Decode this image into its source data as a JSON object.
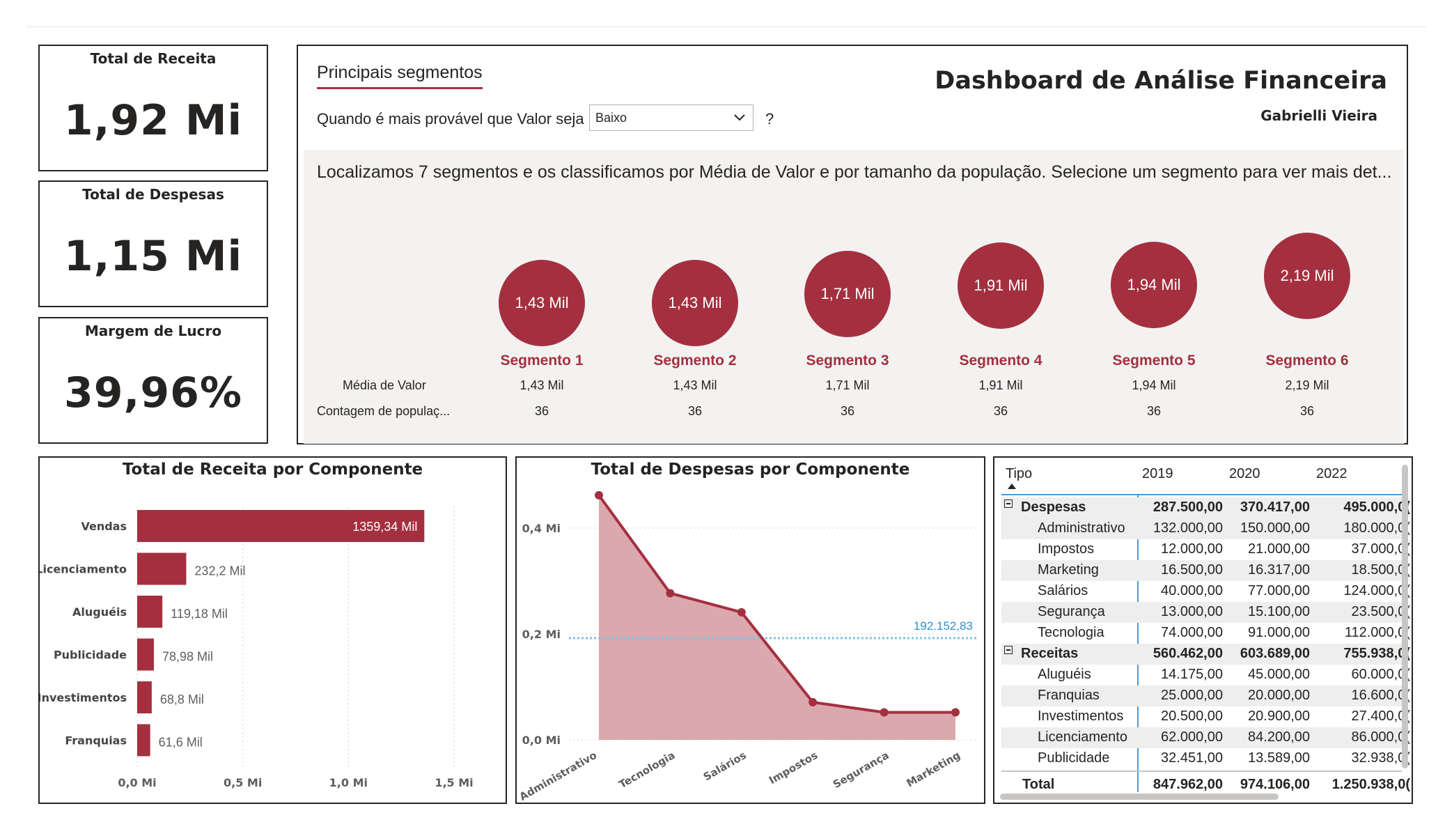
{
  "kpis": [
    {
      "title": "Total de Receita",
      "value": "1,92 Mi"
    },
    {
      "title": "Total de Despesas",
      "value": "1,15 Mi"
    },
    {
      "title": "Margem de Lucro",
      "value": "39,96%"
    }
  ],
  "segments_panel": {
    "tab_label": "Principais segmentos",
    "question_label": "Quando é mais provável que Valor seja",
    "dropdown_value": "Baixo",
    "help_label": "?",
    "dashboard_title": "Dashboard de Análise Financeira",
    "author": "Gabrielli Vieira",
    "description": "Localizamos 7 segmentos e os classificamos por Média de Valor e por tamanho da população. Selecione um segmento para ver mais det...",
    "row_labels": {
      "media": "Média de Valor",
      "contagem": "Contagem de populaç..."
    },
    "segments": [
      {
        "name": "Segmento 1",
        "bubble": "1,43 Mil",
        "media": "1,43 Mil",
        "contagem": "36",
        "value": 1.43
      },
      {
        "name": "Segmento 2",
        "bubble": "1,43 Mil",
        "media": "1,43 Mil",
        "contagem": "36",
        "value": 1.43
      },
      {
        "name": "Segmento 3",
        "bubble": "1,71 Mil",
        "media": "1,71 Mil",
        "contagem": "36",
        "value": 1.71
      },
      {
        "name": "Segmento 4",
        "bubble": "1,91 Mil",
        "media": "1,91 Mil",
        "contagem": "36",
        "value": 1.91
      },
      {
        "name": "Segmento 5",
        "bubble": "1,94 Mil",
        "media": "1,94 Mil",
        "contagem": "36",
        "value": 1.94
      },
      {
        "name": "Segmento 6",
        "bubble": "2,19 Mil",
        "media": "2,19 Mil",
        "contagem": "36",
        "value": 2.19
      }
    ]
  },
  "chart_data": [
    {
      "type": "bar",
      "title": "Total de Receita por Componente",
      "orientation": "horizontal",
      "categories": [
        "Vendas",
        "Licenciamento",
        "Aluguéis",
        "Publicidade",
        "Investimentos",
        "Franquias"
      ],
      "values": [
        1359.34,
        232.2,
        119.18,
        78.98,
        68.8,
        61.6
      ],
      "data_labels": [
        "1359,34 Mil",
        "232,2 Mil",
        "119,18 Mil",
        "78,98 Mil",
        "68,8 Mil",
        "61,6 Mil"
      ],
      "xticks": [
        "0,0 Mi",
        "0,5 Mi",
        "1,0 Mi",
        "1,5 Mi"
      ],
      "xtick_values": [
        0,
        500,
        1000,
        1500
      ],
      "xlim": [
        0,
        1500
      ],
      "color": "#a4303f",
      "grid": true
    },
    {
      "type": "area",
      "title": "Total de Despesas por Componente",
      "categories": [
        "Administrativo",
        "Tecnologia",
        "Salários",
        "Impostos",
        "Segurança",
        "Marketing"
      ],
      "values": [
        0.462,
        0.277,
        0.241,
        0.071,
        0.052,
        0.052
      ],
      "yticks": [
        "0,0 Mi",
        "0,2 Mi",
        "0,4 Mi"
      ],
      "ytick_values": [
        0,
        0.2,
        0.4
      ],
      "ylim": [
        0,
        0.5
      ],
      "reference_line": {
        "value": 0.19215283,
        "label": "192.152,83"
      },
      "line_color": "#a4303f",
      "fill_color": "#dba8ae",
      "grid": true
    }
  ],
  "matrix": {
    "headers": [
      "Tipo",
      "2019",
      "2020",
      "2022"
    ],
    "rows": [
      {
        "label": "Despesas",
        "group": true,
        "values": [
          "287.500,00",
          "370.417,00",
          "495.000,0("
        ]
      },
      {
        "label": "Administrativo",
        "values": [
          "132.000,00",
          "150.000,00",
          "180.000,0("
        ]
      },
      {
        "label": "Impostos",
        "values": [
          "12.000,00",
          "21.000,00",
          "37.000,0("
        ]
      },
      {
        "label": "Marketing",
        "values": [
          "16.500,00",
          "16.317,00",
          "18.500,0("
        ]
      },
      {
        "label": "Salários",
        "values": [
          "40.000,00",
          "77.000,00",
          "124.000,0("
        ]
      },
      {
        "label": "Segurança",
        "values": [
          "13.000,00",
          "15.100,00",
          "23.500,0("
        ]
      },
      {
        "label": "Tecnologia",
        "values": [
          "74.000,00",
          "91.000,00",
          "112.000,0("
        ]
      },
      {
        "label": "Receitas",
        "group": true,
        "values": [
          "560.462,00",
          "603.689,00",
          "755.938,0("
        ]
      },
      {
        "label": "Aluguéis",
        "values": [
          "14.175,00",
          "45.000,00",
          "60.000,0("
        ]
      },
      {
        "label": "Franquias",
        "values": [
          "25.000,00",
          "20.000,00",
          "16.600,0("
        ]
      },
      {
        "label": "Investimentos",
        "values": [
          "20.500,00",
          "20.900,00",
          "27.400,0("
        ]
      },
      {
        "label": "Licenciamento",
        "values": [
          "62.000,00",
          "84.200,00",
          "86.000,0("
        ]
      },
      {
        "label": "Publicidade",
        "values": [
          "32.451,00",
          "13.589,00",
          "32.938,0("
        ]
      }
    ],
    "total": {
      "label": "Total",
      "values": [
        "847.962,00",
        "974.106,00",
        "1.250.938,0("
      ]
    }
  }
}
